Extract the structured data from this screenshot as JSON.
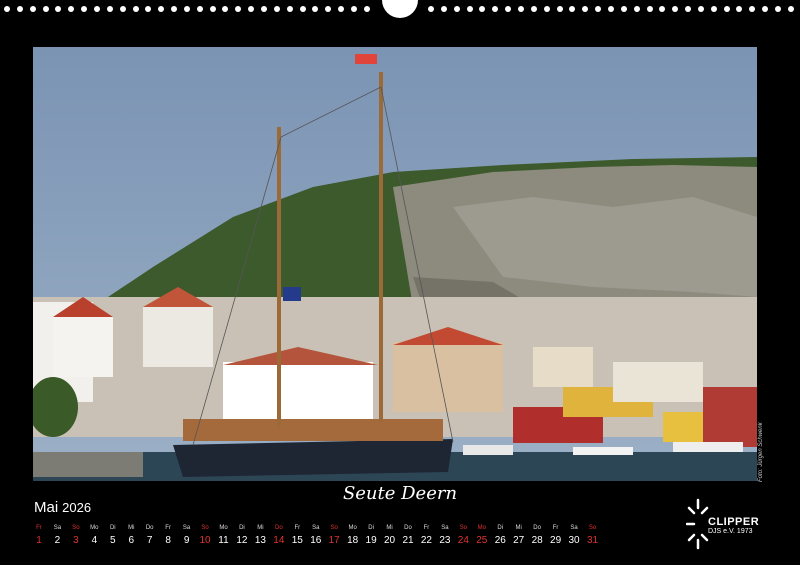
{
  "caption": "Seute Deern",
  "month": {
    "name": "Mai",
    "year": "2026"
  },
  "photo_credit": "Foto: Jürgen Schwenk",
  "logo": {
    "line1": "CLIPPER",
    "line2": "DJS e.V. 1973",
    "icon": "star-burst-icon"
  },
  "calendar": [
    {
      "wd": "Fr",
      "d": "1",
      "hol": true
    },
    {
      "wd": "Sa",
      "d": "2",
      "hol": false
    },
    {
      "wd": "So",
      "d": "3",
      "hol": true
    },
    {
      "wd": "Mo",
      "d": "4",
      "hol": false
    },
    {
      "wd": "Di",
      "d": "5",
      "hol": false
    },
    {
      "wd": "Mi",
      "d": "6",
      "hol": false
    },
    {
      "wd": "Do",
      "d": "7",
      "hol": false
    },
    {
      "wd": "Fr",
      "d": "8",
      "hol": false
    },
    {
      "wd": "Sa",
      "d": "9",
      "hol": false
    },
    {
      "wd": "So",
      "d": "10",
      "hol": true
    },
    {
      "wd": "Mo",
      "d": "11",
      "hol": false
    },
    {
      "wd": "Di",
      "d": "12",
      "hol": false
    },
    {
      "wd": "Mi",
      "d": "13",
      "hol": false
    },
    {
      "wd": "Do",
      "d": "14",
      "hol": true
    },
    {
      "wd": "Fr",
      "d": "15",
      "hol": false
    },
    {
      "wd": "Sa",
      "d": "16",
      "hol": false
    },
    {
      "wd": "So",
      "d": "17",
      "hol": true
    },
    {
      "wd": "Mo",
      "d": "18",
      "hol": false
    },
    {
      "wd": "Di",
      "d": "19",
      "hol": false
    },
    {
      "wd": "Mi",
      "d": "20",
      "hol": false
    },
    {
      "wd": "Do",
      "d": "21",
      "hol": false
    },
    {
      "wd": "Fr",
      "d": "22",
      "hol": false
    },
    {
      "wd": "Sa",
      "d": "23",
      "hol": false
    },
    {
      "wd": "So",
      "d": "24",
      "hol": true
    },
    {
      "wd": "Mo",
      "d": "25",
      "hol": true
    },
    {
      "wd": "Di",
      "d": "26",
      "hol": false
    },
    {
      "wd": "Mi",
      "d": "27",
      "hol": false
    },
    {
      "wd": "Do",
      "d": "28",
      "hol": false
    },
    {
      "wd": "Fr",
      "d": "29",
      "hol": false
    },
    {
      "wd": "Sa",
      "d": "30",
      "hol": false
    },
    {
      "wd": "So",
      "d": "31",
      "hol": true
    }
  ],
  "colors": {
    "background": "#000000",
    "holiday": "#e0322f",
    "text": "#ffffff"
  }
}
